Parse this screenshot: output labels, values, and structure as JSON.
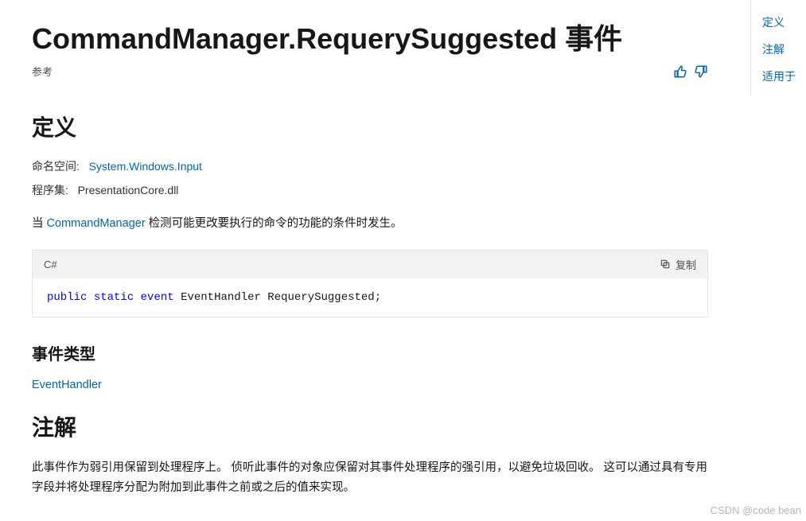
{
  "header": {
    "title": "CommandManager.RequerySuggested 事件",
    "reference": "参考"
  },
  "feedback": {
    "up_label": "helpful",
    "down_label": "not helpful"
  },
  "sections": {
    "definition_heading": "定义",
    "namespace_label": "命名空间:",
    "namespace_value": "System.Windows.Input",
    "assembly_label": "程序集:",
    "assembly_value": "PresentationCore.dll",
    "desc_pre": "当 ",
    "desc_link": "CommandManager",
    "desc_post": " 检测可能更改要执行的命令的功能的条件时发生。",
    "code_lang": "C#",
    "copy_label": "复制",
    "code_kw_public": "public",
    "code_kw_static": "static",
    "code_kw_event": "event",
    "code_rest": " EventHandler RequerySuggested;",
    "event_type_heading": "事件类型",
    "event_type_link": "EventHandler",
    "remarks_heading": "注解",
    "remarks_body": "此事件作为弱引用保留到处理程序上。 侦听此事件的对象应保留对其事件处理程序的强引用，以避免垃圾回收。 这可以通过具有专用字段并将处理程序分配为附加到此事件之前或之后的值来实现。"
  },
  "sidebar": {
    "item1": "定义",
    "item2": "注解",
    "item3": "适用于"
  },
  "watermark": "CSDN @code bean"
}
